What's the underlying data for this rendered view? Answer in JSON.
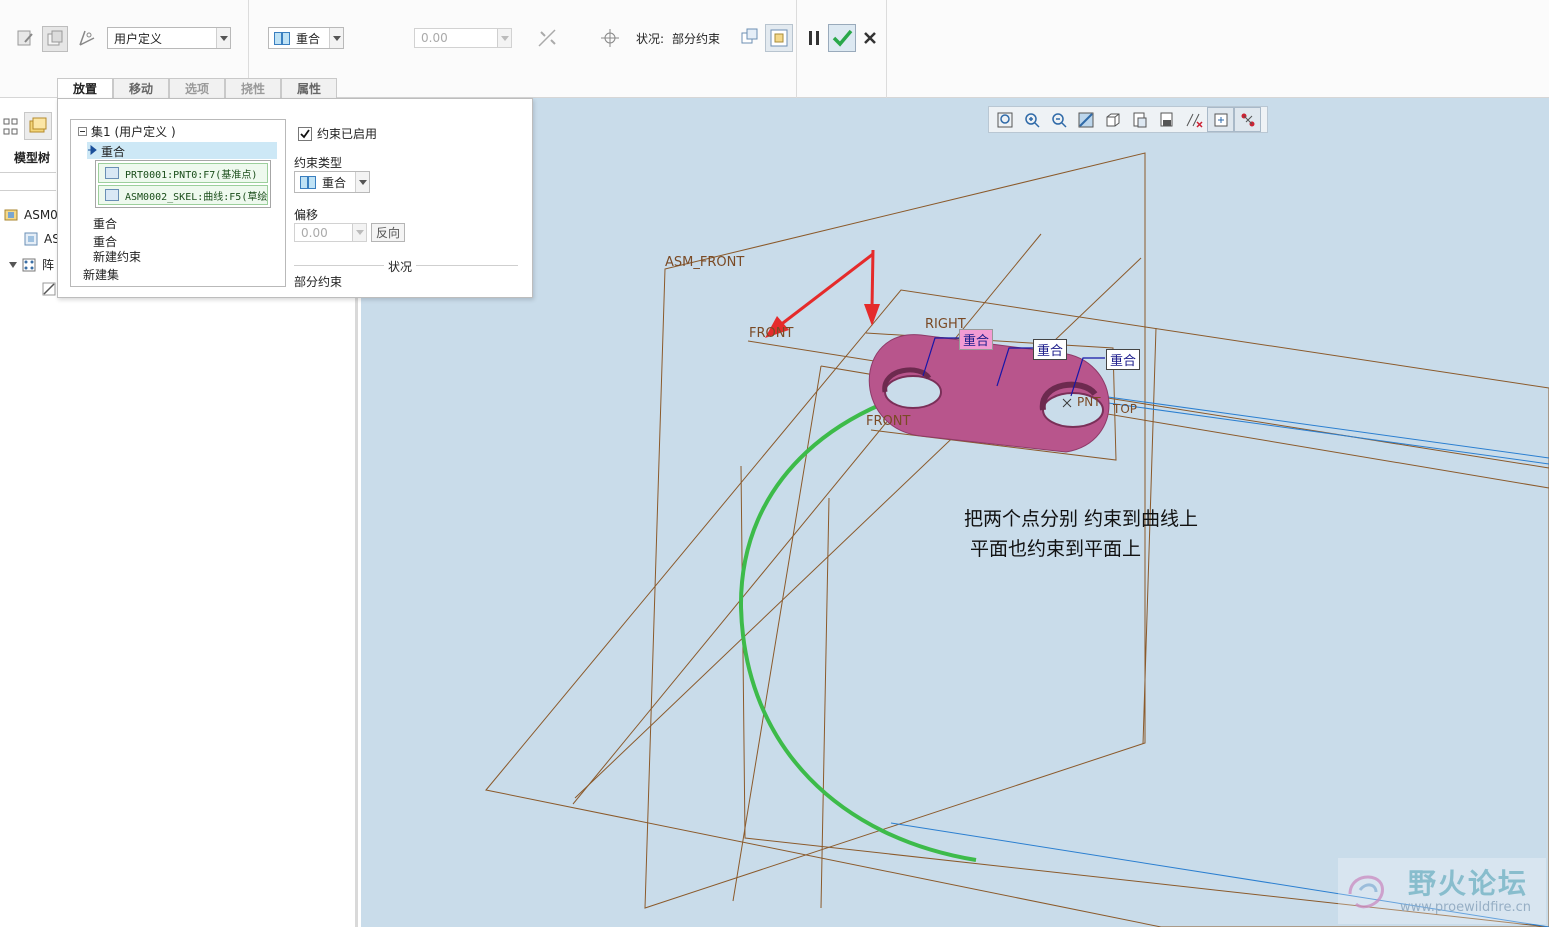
{
  "toolbar": {
    "user_defined_combo": "用户定义",
    "constraint_type_combo": "重合",
    "offset_value": "0.00",
    "status_label": "状况:",
    "status_value": "部分约束"
  },
  "tabs": [
    {
      "label": "放置"
    },
    {
      "label": "移动"
    },
    {
      "label": "选项"
    },
    {
      "label": "挠性"
    },
    {
      "label": "属性"
    }
  ],
  "tree": {
    "title": "模型树",
    "items": [
      {
        "label": "ASM0"
      },
      {
        "label": "AS"
      },
      {
        "label": "阵"
      }
    ]
  },
  "panel": {
    "set_header": "集1 (用户定义 )",
    "selected_constraint": "重合",
    "references": [
      {
        "label": "PRT0001:PNT0:F7(基准点)"
      },
      {
        "label": "ASM0002_SKEL:曲线:F5(草绘"
      }
    ],
    "constraints": [
      "重合",
      "重合"
    ],
    "new_constraint": "新建约束",
    "new_set": "新建集",
    "enabled_label": "约束已启用",
    "enabled": true,
    "constraint_type_label": "约束类型",
    "constraint_type_value": "重合",
    "offset_label": "偏移",
    "offset_value": "0.00",
    "flip_button": "反向",
    "status_header": "状况",
    "status_text": "部分约束"
  },
  "viewport": {
    "datum_labels": {
      "asm_front": "ASM_FRONT",
      "front": "FRONT",
      "front2": "FRONT",
      "right": "RIGHT",
      "pnt": "PNT",
      "top": "TOP"
    },
    "constraint_tags": [
      "重合",
      "重合",
      "重合"
    ],
    "annotation_line1": "把两个点分别 约束到曲线上",
    "annotation_line2": "平面也约束到平面上",
    "watermark_text": "野火论坛",
    "watermark_url": "www.proewildfire.cn"
  },
  "colors": {
    "viewport_bg": "#c9dcea",
    "datum_plane": "#8b5a2b",
    "part": "#b8558c",
    "curve": "#3dbb4a",
    "arrow": "#e52b2b",
    "edge_blue": "#2b7fd0"
  }
}
